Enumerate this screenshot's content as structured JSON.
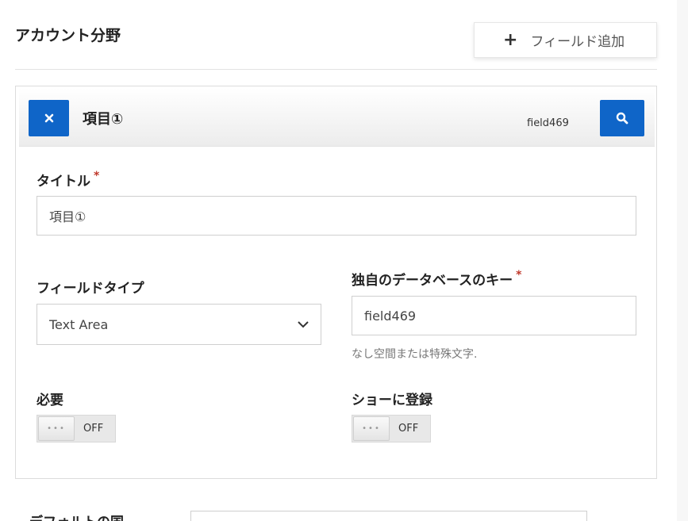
{
  "section": {
    "title": "アカウント分野",
    "add_field_label": "フィールド追加"
  },
  "card": {
    "title": "項目①",
    "field_key": "field469"
  },
  "form": {
    "title_label": "タイトル",
    "title_value": "項目①",
    "field_type_label": "フィールドタイプ",
    "field_type_value": "Text Area",
    "db_key_label": "独自のデータベースのキー",
    "db_key_value": "field469",
    "db_key_hint": "なし空間または特殊文字.",
    "required_label": "必要",
    "required_state": "OFF",
    "show_register_label": "ショーに登録",
    "show_register_state": "OFF",
    "required_mark": "*"
  },
  "footer": {
    "default_country_label": "デフォルトの国"
  },
  "colors": {
    "accent": "#0f65c8",
    "required": "#c0392b"
  },
  "icons": {
    "add": "plus-icon",
    "remove": "close-icon",
    "search": "search-icon",
    "dropdown": "chevron-down-icon"
  }
}
